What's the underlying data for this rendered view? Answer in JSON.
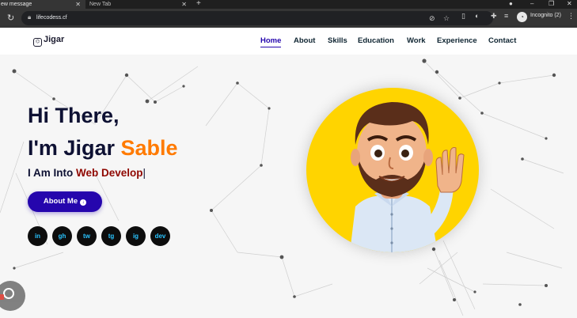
{
  "browser": {
    "tabs": [
      {
        "title": "ew message",
        "active": true
      },
      {
        "title": "New Tab",
        "active": false
      }
    ],
    "url": "lifecodess.cf",
    "profile_label": "Incognito (2)",
    "icons": [
      "reload-icon",
      "lock-icon",
      "eye-off-icon",
      "star-icon",
      "extension-icon",
      "puzzle-icon",
      "reading-list-icon",
      "incognito-icon",
      "kebab-menu-icon"
    ]
  },
  "site": {
    "logo": "Jigar",
    "nav": [
      {
        "label": "Home",
        "active": true
      },
      {
        "label": "About",
        "active": false
      },
      {
        "label": "Skills",
        "active": false
      },
      {
        "label": "Education",
        "active": false
      },
      {
        "label": "Work",
        "active": false
      },
      {
        "label": "Experience",
        "active": false
      },
      {
        "label": "Contact",
        "active": false
      }
    ]
  },
  "hero": {
    "greeting": "Hi There,",
    "intro_prefix": "I'm Jigar ",
    "intro_highlight": "Sable",
    "subtitle_prefix": "I Am Into ",
    "subtitle_typed": "Web Develop",
    "cursor": "|",
    "button_label": "About Me",
    "socials": [
      {
        "name": "linkedin-icon",
        "glyph": "in"
      },
      {
        "name": "github-icon",
        "glyph": "gh"
      },
      {
        "name": "twitter-icon",
        "glyph": "tw"
      },
      {
        "name": "telegram-icon",
        "glyph": "tg"
      },
      {
        "name": "instagram-icon",
        "glyph": "ig"
      },
      {
        "name": "dev-icon",
        "glyph": "dev"
      }
    ]
  },
  "colors": {
    "accent": "#2506ad",
    "highlight": "#ff7a00",
    "typed": "#8f0700",
    "avatar_bg": "#ffd400",
    "social_icon": "#29c4ff"
  }
}
